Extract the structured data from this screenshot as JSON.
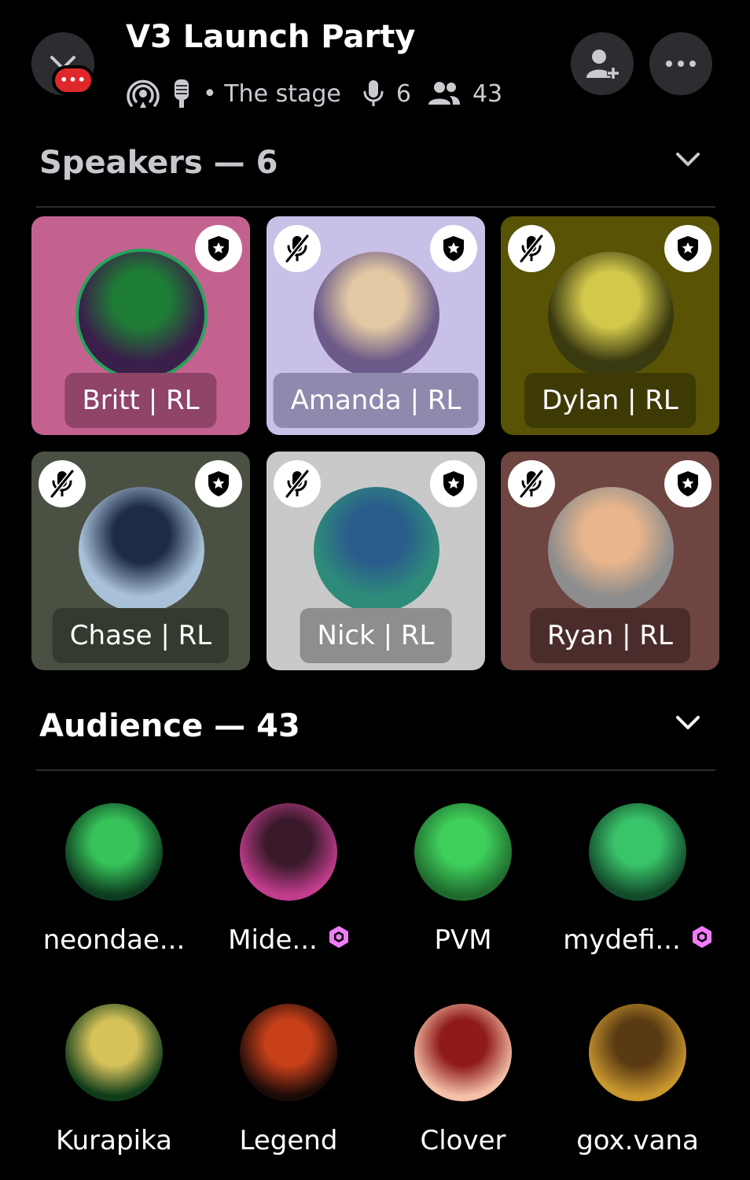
{
  "header": {
    "title": "V3 Launch Party",
    "notification_badge": "•••",
    "channel_name": "• The stage",
    "speaker_count": "6",
    "listener_count": "43"
  },
  "speakers_section": {
    "title": "Speakers — 6"
  },
  "speakers": [
    {
      "name": "Britt | RL",
      "tile_color": "#c4628f",
      "name_bg": "#8f4468",
      "muted": false,
      "speaking": true,
      "avatar_colors": [
        "#3a1f4a",
        "#1e7d35"
      ]
    },
    {
      "name": "Amanda | RL",
      "tile_color": "#c8c0e6",
      "name_bg": "#9189ad",
      "muted": true,
      "speaking": false,
      "avatar_colors": [
        "#6b5a8a",
        "#e3c9a3"
      ]
    },
    {
      "name": "Dylan | RL",
      "tile_color": "#595306",
      "name_bg": "#3d3a06",
      "muted": true,
      "speaking": false,
      "avatar_colors": [
        "#3a3a10",
        "#d2c84a"
      ]
    },
    {
      "name": "Chase | RL",
      "tile_color": "#4a5143",
      "name_bg": "#333a2e",
      "muted": true,
      "speaking": false,
      "avatar_colors": [
        "#a8c1d8",
        "#1e2b46"
      ]
    },
    {
      "name": "Nick | RL",
      "tile_color": "#c9c9c9",
      "name_bg": "#8e8e8e",
      "muted": true,
      "speaking": false,
      "avatar_colors": [
        "#2e8b7a",
        "#2a5c8c"
      ]
    },
    {
      "name": "Ryan | RL",
      "tile_color": "#6e4541",
      "name_bg": "#4a2d2a",
      "muted": true,
      "speaking": false,
      "avatar_colors": [
        "#8d8d8d",
        "#e8b58c"
      ]
    }
  ],
  "audience_section": {
    "title": "Audience — 43"
  },
  "audience": [
    {
      "name": "neondae...",
      "boost": false,
      "avatar_colors": [
        "#0d3b1f",
        "#37c25a"
      ]
    },
    {
      "name": "Mide...",
      "boost": true,
      "avatar_colors": [
        "#c23d8e",
        "#3a1a2a"
      ]
    },
    {
      "name": "PVM",
      "boost": false,
      "avatar_colors": [
        "#1f6b2e",
        "#3fcf5b"
      ]
    },
    {
      "name": "mydefi...",
      "boost": true,
      "avatar_colors": [
        "#134a2a",
        "#3ac46a"
      ]
    },
    {
      "name": "Kurapika",
      "boost": false,
      "avatar_colors": [
        "#0f3d1a",
        "#d7c25a"
      ]
    },
    {
      "name": "Legend",
      "boost": false,
      "avatar_colors": [
        "#1a0a08",
        "#c8401a"
      ]
    },
    {
      "name": "Clover",
      "boost": false,
      "avatar_colors": [
        "#f4c1a8",
        "#8e1a1a"
      ]
    },
    {
      "name": "gox.vana",
      "boost": false,
      "avatar_colors": [
        "#c9982f",
        "#5a3a12"
      ]
    }
  ],
  "colors": {
    "boost": "#f07cf7",
    "speaking_ring": "#23a55a",
    "button_bg": "#2b2d31",
    "notification": "#e0272b"
  }
}
